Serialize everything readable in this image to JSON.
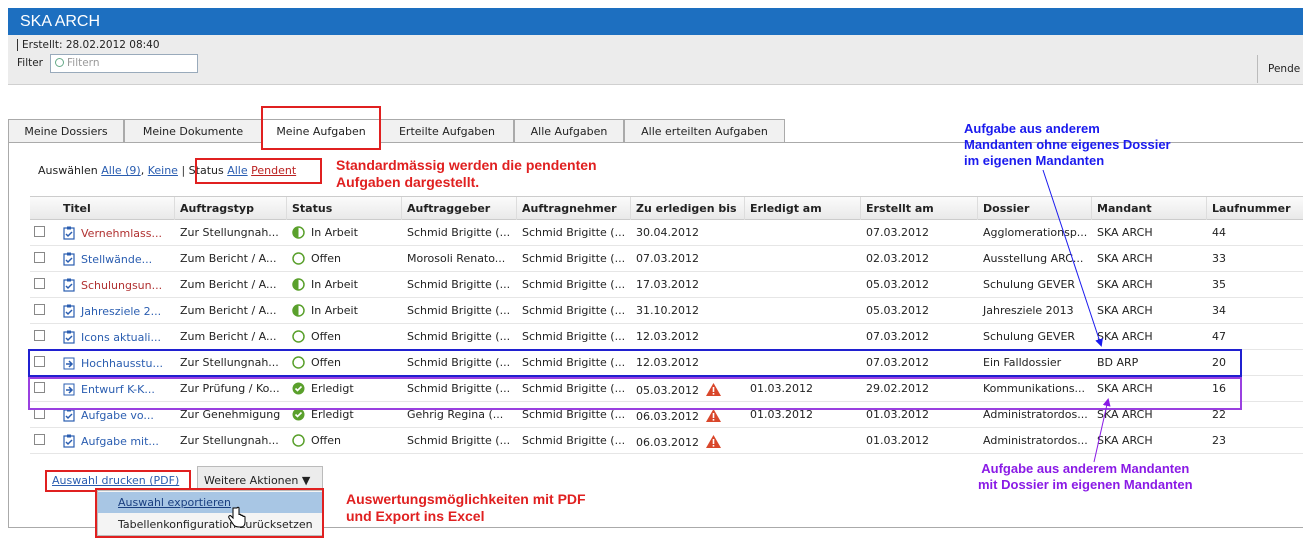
{
  "app": {
    "title": "SKA ARCH"
  },
  "meta": {
    "created": "Erstellt: 28.02.2012 08:40",
    "filter_label": "Filter",
    "filter_placeholder": "Filtern",
    "right_label": "Pende"
  },
  "tabs": [
    "Meine Dossiers",
    "Meine Dokumente",
    "Meine Aufgaben",
    "Erteilte Aufgaben",
    "Alle Aufgaben",
    "Alle erteilten Aufgaben"
  ],
  "selection": {
    "label": "Auswählen",
    "all": "Alle (9)",
    "comma": ",",
    "none": "Keine",
    "status_label": "Status",
    "status_all": "Alle",
    "status_pending": "Pendent"
  },
  "table": {
    "headers": [
      "Titel",
      "Auftragstyp",
      "Status",
      "Auftraggeber",
      "Auftragnehmer",
      "Zu erledigen bis",
      "Erledigt am",
      "Erstellt am",
      "Dossier",
      "Mandant",
      "Laufnummer"
    ],
    "rows": [
      {
        "title": "Vernehmlass...",
        "type": "Zur Stellungnah...",
        "status": "In Arbeit",
        "giver": "Schmid Brigitte (...",
        "taker": "Schmid Brigitte (...",
        "due": "30.04.2012",
        "done": "",
        "created": "07.03.2012",
        "dossier": "Agglomerationsp...",
        "mandant": "SKA ARCH",
        "nr": "44"
      },
      {
        "title": "Stellwände...",
        "type": "Zum Bericht / A...",
        "status": "Offen",
        "giver": "Morosoli Renato...",
        "taker": "Schmid Brigitte (...",
        "due": "07.03.2012",
        "done": "",
        "created": "02.03.2012",
        "dossier": "Ausstellung ARC...",
        "mandant": "SKA ARCH",
        "nr": "33"
      },
      {
        "title": "Schulungsun...",
        "type": "Zum Bericht / A...",
        "status": "In Arbeit",
        "giver": "Schmid Brigitte (...",
        "taker": "Schmid Brigitte (...",
        "due": "17.03.2012",
        "done": "",
        "created": "05.03.2012",
        "dossier": "Schulung GEVER",
        "mandant": "SKA ARCH",
        "nr": "35"
      },
      {
        "title": "Jahresziele 2...",
        "type": "Zum Bericht / A...",
        "status": "In Arbeit",
        "giver": "Schmid Brigitte (...",
        "taker": "Schmid Brigitte (...",
        "due": "31.10.2012",
        "done": "",
        "created": "05.03.2012",
        "dossier": "Jahresziele 2013",
        "mandant": "SKA ARCH",
        "nr": "34"
      },
      {
        "title": "Icons aktuali...",
        "type": "Zum Bericht / A...",
        "status": "Offen",
        "giver": "Schmid Brigitte (...",
        "taker": "Schmid Brigitte (...",
        "due": "12.03.2012",
        "done": "",
        "created": "07.03.2012",
        "dossier": "Schulung GEVER",
        "mandant": "SKA ARCH",
        "nr": "47"
      },
      {
        "title": "Hochhausstu...",
        "type": "Zur Stellungnah...",
        "status": "Offen",
        "giver": "Schmid Brigitte (...",
        "taker": "Schmid Brigitte (...",
        "due": "12.03.2012",
        "done": "",
        "created": "07.03.2012",
        "dossier": "Ein Falldossier",
        "mandant": "BD ARP",
        "nr": "20"
      },
      {
        "title": "Entwurf K-K...",
        "type": "Zur Prüfung / Ko...",
        "status": "Erledigt",
        "giver": "Schmid Brigitte (...",
        "taker": "Schmid Brigitte (...",
        "due": "05.03.2012",
        "done": "01.03.2012",
        "created": "29.02.2012",
        "dossier": "Kommunikations...",
        "mandant": "SKA ARCH",
        "nr": "16"
      },
      {
        "title": "Aufgabe vo...",
        "type": "Zur Genehmigung",
        "status": "Erledigt",
        "giver": "Gehrig Regina (...",
        "taker": "Schmid Brigitte (...",
        "due": "06.03.2012",
        "done": "01.03.2012",
        "created": "01.03.2012",
        "dossier": "Administratordos...",
        "mandant": "SKA ARCH",
        "nr": "22"
      },
      {
        "title": "Aufgabe mit...",
        "type": "Zur Stellungnah...",
        "status": "Offen",
        "giver": "Schmid Brigitte (...",
        "taker": "Schmid Brigitte (...",
        "due": "06.03.2012",
        "done": "",
        "created": "01.03.2012",
        "dossier": "Administratordos...",
        "mandant": "SKA ARCH",
        "nr": "23"
      }
    ]
  },
  "actions": {
    "print": "Auswahl drucken (PDF)",
    "more": "Weitere Aktionen ▼",
    "export": "Auswahl exportieren",
    "reset": "Tabellenkonfiguration zurücksetzen"
  },
  "annotations": {
    "default_line1": "Standardmässig werden die pendenten",
    "default_line2": "Aufgaben dargestellt.",
    "blue_line1": "Aufgabe aus anderem",
    "blue_line2": "Mandanten ohne eigenes Dossier",
    "blue_line3": "im eigenen Mandanten",
    "purple_line1": "Aufgabe aus anderem Mandanten",
    "purple_line2": "mit Dossier im eigenen Mandanten",
    "export_line1": "Auswertungsmöglichkeiten mit PDF",
    "export_line2": "und Export ins Excel"
  },
  "colors": {
    "brand": "#1d6fc0",
    "annotation_red": "#e02020",
    "annotation_blue": "#1a1aee",
    "annotation_purple": "#8a1ae6",
    "link": "#2a5db0"
  }
}
